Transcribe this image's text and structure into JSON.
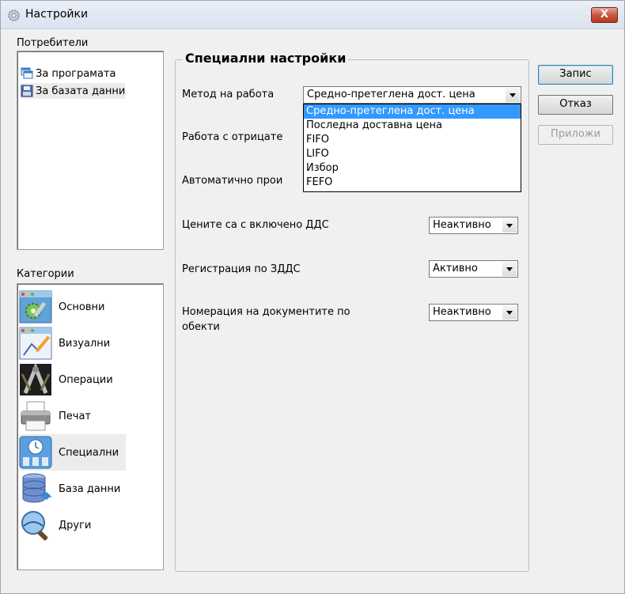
{
  "window": {
    "title": "Настройки",
    "close_label": "X"
  },
  "users": {
    "label": "Потребители",
    "items": [
      {
        "label": "За програмата",
        "icon": "windows-icon"
      },
      {
        "label": "За базата данни",
        "icon": "floppy-disk-icon"
      }
    ]
  },
  "categories": {
    "label": "Категории",
    "items": [
      {
        "label": "Основни",
        "icon": "basic-settings-icon"
      },
      {
        "label": "Визуални",
        "icon": "visual-settings-icon"
      },
      {
        "label": "Операции",
        "icon": "operations-icon"
      },
      {
        "label": "Печат",
        "icon": "printer-icon"
      },
      {
        "label": "Специални",
        "icon": "special-clock-icon",
        "selected": true
      },
      {
        "label": "База данни",
        "icon": "database-icon"
      },
      {
        "label": "Други",
        "icon": "search-globe-icon"
      }
    ]
  },
  "special": {
    "title": "Специални настройки",
    "method_label": "Метод на работа",
    "method_value": "Средно-претеглена дост. цена",
    "method_options": [
      "Средно-претеглена дост. цена",
      "Последна доставна цена",
      "FIFO",
      "LIFO",
      "Избор",
      "FEFO"
    ],
    "negative_label_visible": "Работа с отрицате",
    "auto_label_visible": "Автоматично прои",
    "vat_prices_label": "Цените са с включено ДДС",
    "vat_prices_value": "Неактивно",
    "vat_reg_label": "Регистрация по ЗДДС",
    "vat_reg_value": "Активно",
    "numbering_label_line1": "Номерация на документите по",
    "numbering_label_line2": "обекти",
    "numbering_value": "Неактивно"
  },
  "buttons": {
    "save": "Запис",
    "cancel": "Отказ",
    "apply": "Приложи"
  },
  "colors": {
    "selection": "#3399ff",
    "close": "#c8523b"
  }
}
